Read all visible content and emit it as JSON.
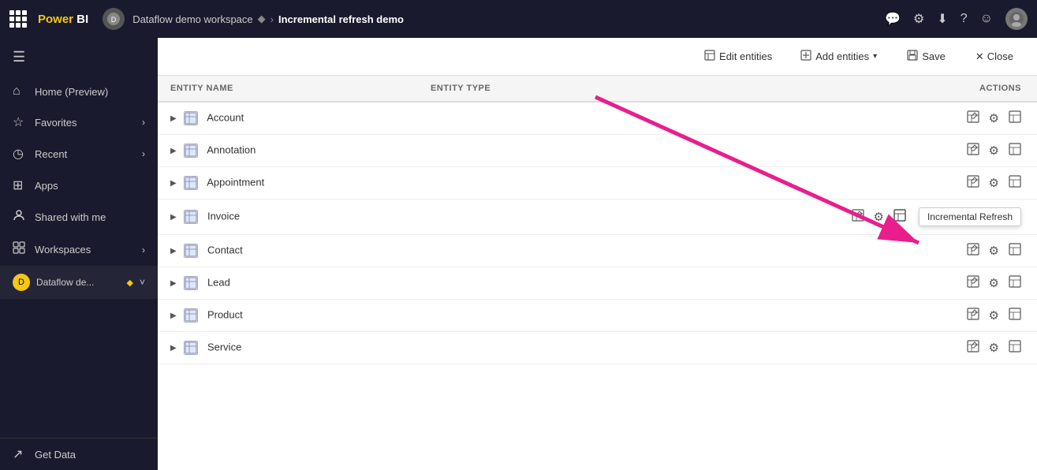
{
  "topbar": {
    "logo_text": "Power BI",
    "workspace_label": "Dataflow demo workspace",
    "page_title": "Incremental refresh demo",
    "icons": [
      "chat-icon",
      "settings-icon",
      "download-icon",
      "help-icon",
      "smiley-icon",
      "user-icon"
    ]
  },
  "sidebar": {
    "toggle_icon": "≡",
    "items": [
      {
        "id": "home",
        "label": "Home (Preview)",
        "icon": "⌂"
      },
      {
        "id": "favorites",
        "label": "Favorites",
        "icon": "☆",
        "has_chevron": true
      },
      {
        "id": "recent",
        "label": "Recent",
        "icon": "◷",
        "has_chevron": true
      },
      {
        "id": "apps",
        "label": "Apps",
        "icon": "⊞"
      },
      {
        "id": "shared",
        "label": "Shared with me",
        "icon": "👤"
      },
      {
        "id": "workspaces",
        "label": "Workspaces",
        "icon": "⊡",
        "has_chevron": true
      }
    ],
    "workspace_item": {
      "label": "Dataflow de...",
      "icon": "D"
    },
    "get_data_label": "Get Data",
    "get_data_icon": "↗"
  },
  "toolbar": {
    "edit_entities_label": "Edit entities",
    "add_entities_label": "Add entities",
    "add_entities_chevron": "▾",
    "save_label": "Save",
    "close_label": "Close"
  },
  "table": {
    "col_entity_name": "ENTITY NAME",
    "col_entity_type": "ENTITY TYPE",
    "col_actions": "ACTIONS",
    "rows": [
      {
        "name": "Account"
      },
      {
        "name": "Annotation"
      },
      {
        "name": "Appointment"
      },
      {
        "name": "Invoice"
      },
      {
        "name": "Contact"
      },
      {
        "name": "Lead"
      },
      {
        "name": "Product"
      },
      {
        "name": "Service"
      }
    ],
    "tooltip_text": "Incremental Refresh"
  }
}
